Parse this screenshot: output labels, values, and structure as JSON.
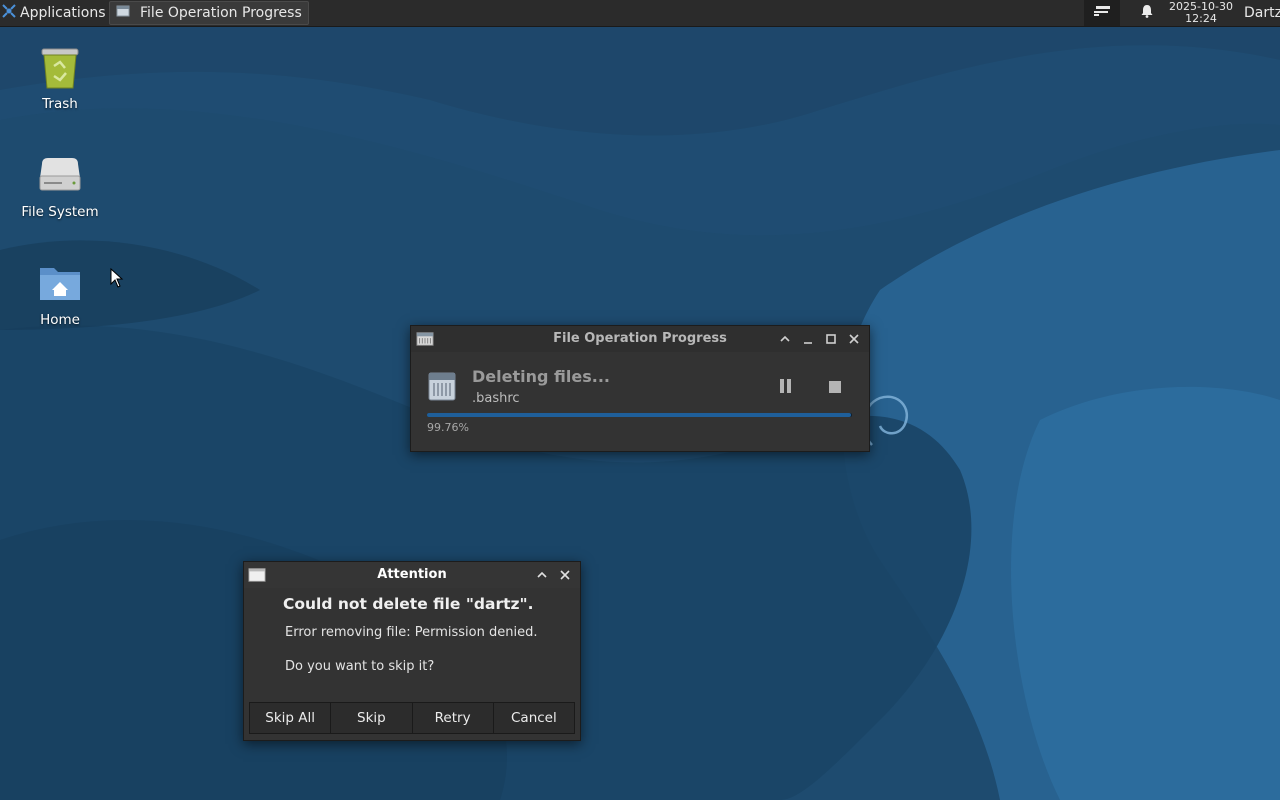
{
  "panel": {
    "applications_label": "Applications",
    "task_title": "File Operation Progress",
    "clock_date": "2025-10-30",
    "clock_time": "12:24",
    "user": "Dartz",
    "icons": [
      "xfce-menu-icon",
      "window-icon",
      "tray-icon",
      "bell-icon"
    ]
  },
  "desktop": {
    "items": [
      {
        "label": "Trash",
        "icon": "trash-icon"
      },
      {
        "label": "File System",
        "icon": "drive-icon"
      },
      {
        "label": "Home",
        "icon": "home-folder-icon"
      }
    ]
  },
  "progress_window": {
    "title": "File Operation Progress",
    "heading": "Deleting files...",
    "current_file": ".bashrc",
    "progress_text": "99.76%",
    "progress_fraction": 0.9976
  },
  "attention_dialog": {
    "title": "Attention",
    "heading": "Could not delete file \"dartz\".",
    "message": "Error removing file: Permission denied.",
    "question": "Do you want to skip it?",
    "buttons": [
      "Skip All",
      "Skip",
      "Retry",
      "Cancel"
    ]
  },
  "colors": {
    "panel_bg": "#2b2b2b",
    "window_bg": "#333333",
    "progress_fill": "#1f5f9a",
    "wallpaper_dark": "#1a4566",
    "wallpaper_light": "#2b6a9a"
  }
}
